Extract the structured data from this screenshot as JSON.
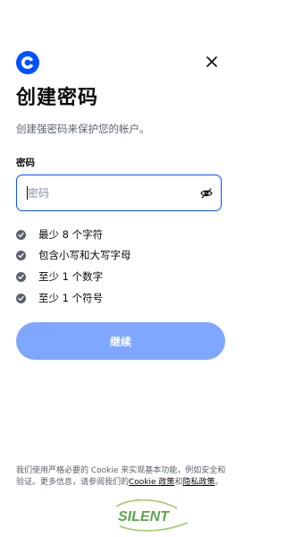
{
  "header": {
    "logo_icon": "coinbase-logo-icon",
    "close_icon": "close-icon"
  },
  "page": {
    "title": "创建密码",
    "subtitle": "创建强密码来保护您的帐户。"
  },
  "password_field": {
    "label": "密码",
    "placeholder": "密码",
    "value": "",
    "toggle_icon": "eye-off-icon"
  },
  "requirements": [
    {
      "text": "最少 8 个字符",
      "icon": "check-circle-icon"
    },
    {
      "text": "包含小写和大写字母",
      "icon": "check-circle-icon"
    },
    {
      "text": "至少 1 个数字",
      "icon": "check-circle-icon"
    },
    {
      "text": "至少 1 个符号",
      "icon": "check-circle-icon"
    }
  ],
  "continue_button": {
    "label": "继续",
    "enabled": false
  },
  "legal": {
    "text_before": "我们使用严格必要的 Cookie 来实现基本功能，例如安全和验证。更多信息，请参阅我们的",
    "cookie_link": "Cookie 政策",
    "and": "和",
    "privacy_link": "隐私政策",
    "end": "。"
  },
  "watermark": {
    "text": "SILENT"
  },
  "colors": {
    "brand_blue": "#0052ff",
    "button_disabled": "#80a7ff",
    "text_primary": "#0a0b0d",
    "text_secondary": "#5b616e"
  }
}
